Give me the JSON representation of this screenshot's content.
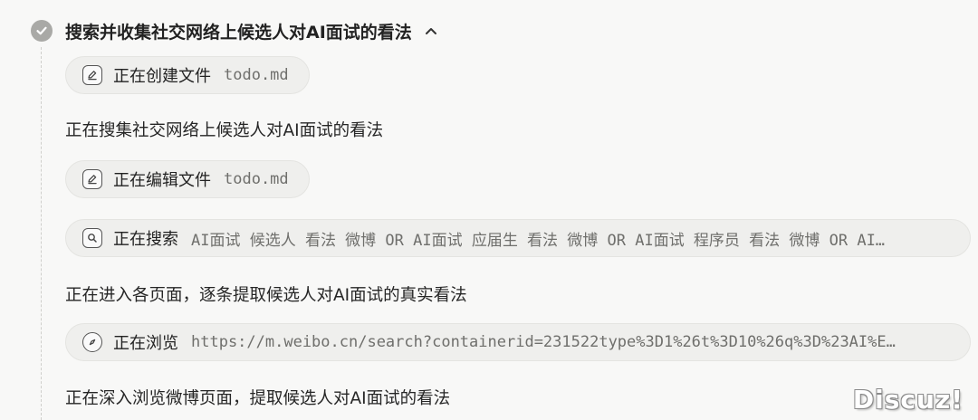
{
  "task": {
    "title": "搜索并收集社交网络上候选人对AI面试的看法"
  },
  "steps": [
    {
      "type": "chip",
      "icon": "edit-icon",
      "label": "正在创建文件",
      "arg": "todo.md"
    },
    {
      "type": "text",
      "text": "正在搜集社交网络上候选人对AI面试的看法"
    },
    {
      "type": "chip",
      "icon": "edit-icon",
      "label": "正在编辑文件",
      "arg": "todo.md"
    },
    {
      "type": "chip",
      "icon": "search-icon",
      "label": "正在搜索",
      "arg": "AI面试 候选人 看法 微博 OR AI面试 应届生 看法 微博 OR AI面试 程序员 看法 微博 OR AI…"
    },
    {
      "type": "text",
      "text": "正在进入各页面，逐条提取候选人对AI面试的真实看法"
    },
    {
      "type": "chip",
      "icon": "compass-icon",
      "label": "正在浏览",
      "arg": "https://m.weibo.cn/search?containerid=231522type%3D1%26t%3D10%26q%3D%23AI%E…"
    },
    {
      "type": "text",
      "text": "正在深入浏览微博页面，提取候选人对AI面试的看法"
    }
  ],
  "watermark": "Discuz!",
  "colors": {
    "background": "#f8f8f7",
    "chip_background": "#efefed",
    "check_circle": "#a9a9a6"
  }
}
